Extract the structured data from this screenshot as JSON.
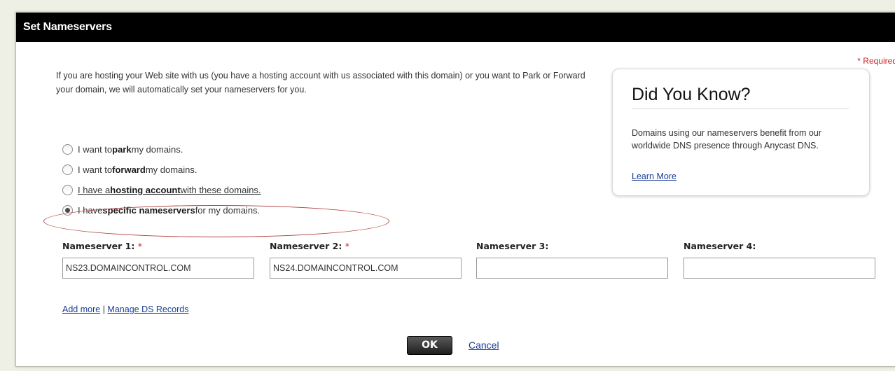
{
  "dialog": {
    "title": "Set Nameservers",
    "required_note": "* Required"
  },
  "intro_text": "If you are hosting your Web site with us (you have a hosting account with us associated with this domain) or you want to Park or Forward your domain, we will automatically set your nameservers for you.",
  "options": [
    {
      "pre": "I want to ",
      "bold": "park",
      "post": " my domains.",
      "checked": false
    },
    {
      "pre": "I want to ",
      "bold": "forward",
      "post": " my domains.",
      "checked": false
    },
    {
      "pre": "I have a ",
      "bold": "hosting account",
      "post": " with these domains.",
      "checked": false
    },
    {
      "pre": "I have ",
      "bold": "specific nameservers",
      "post": " for my domains.",
      "checked": true
    }
  ],
  "nameservers": [
    {
      "label": "Nameserver 1:",
      "required": "*",
      "value": "NS23.DOMAINCONTROL.COM"
    },
    {
      "label": "Nameserver 2:",
      "required": "*",
      "value": "NS24.DOMAINCONTROL.COM"
    },
    {
      "label": "Nameserver 3:",
      "required": "",
      "value": ""
    },
    {
      "label": "Nameserver 4:",
      "required": "",
      "value": ""
    }
  ],
  "links": {
    "add_more": "Add more",
    "separator": "|",
    "manage_ds": "Manage DS Records"
  },
  "buttons": {
    "ok": "OK",
    "cancel": "Cancel"
  },
  "did_you_know": {
    "title": "Did You Know?",
    "body": "Domains using our nameservers benefit from our worldwide DNS presence through Anycast DNS.",
    "link": "Learn More"
  },
  "colors": {
    "title_bar": "#000000",
    "link": "#1a3d99",
    "required": "#cc2222",
    "highlight_ellipse": "#b04040"
  }
}
